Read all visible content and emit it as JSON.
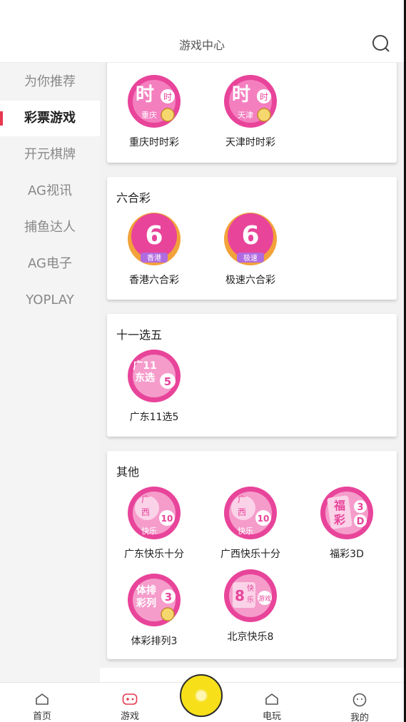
{
  "header": {
    "title": "游戏中心"
  },
  "sidebar": {
    "items": [
      {
        "label": "为你推荐"
      },
      {
        "label": "彩票游戏"
      },
      {
        "label": "开元棋牌"
      },
      {
        "label": "AG视讯"
      },
      {
        "label": "捕鱼达人"
      },
      {
        "label": "AG电子"
      },
      {
        "label": "YOPLAY"
      }
    ],
    "active_index": 1
  },
  "sections": [
    {
      "title": "",
      "games": [
        {
          "label": "重庆时时彩",
          "icon_text": "时",
          "badge": "时",
          "sub": "重庆"
        },
        {
          "label": "天津时时彩",
          "icon_text": "时",
          "badge": "时",
          "sub": "天津"
        }
      ]
    },
    {
      "title": "六合彩",
      "games": [
        {
          "label": "香港六合彩",
          "icon_text": "6",
          "sub": "香港"
        },
        {
          "label": "极速六合彩",
          "icon_text": "6",
          "sub": "极速"
        }
      ]
    },
    {
      "title": "十一选五",
      "games": [
        {
          "label": "广东11选5",
          "icon_text": "广11",
          "icon_text2": "东选",
          "badge": "5"
        }
      ]
    },
    {
      "title": "其他",
      "games": [
        {
          "label": "广东快乐十分",
          "icon_text": "广",
          "icon_text2": "西",
          "badge": "10",
          "sub": "快乐"
        },
        {
          "label": "广西快乐十分",
          "icon_text": "广",
          "icon_text2": "西",
          "badge": "10",
          "sub": "快乐"
        },
        {
          "label": "福彩3D",
          "icon_text": "福",
          "icon_text2": "彩",
          "badge": "3",
          "badge2": "D"
        },
        {
          "label": "体彩排列3",
          "icon_text": "体排",
          "icon_text2": "彩列",
          "badge": "3"
        },
        {
          "label": "北京快乐8",
          "icon_text": "8",
          "badge": "快",
          "badge2": "乐",
          "sub": "游戏"
        }
      ]
    }
  ],
  "tabbar": {
    "items": [
      {
        "label": "首页"
      },
      {
        "label": "游戏"
      },
      {
        "label": "电玩"
      },
      {
        "label": "我的"
      }
    ],
    "active_index": 1
  },
  "colors": {
    "accent": "#e8384f",
    "icon_pink": "#e8449a",
    "center_yellow": "#f7e01a"
  }
}
